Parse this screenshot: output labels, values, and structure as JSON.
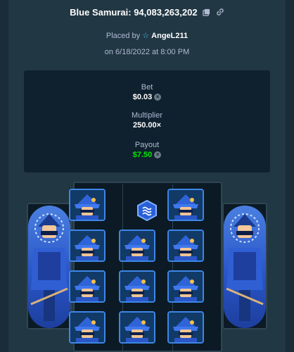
{
  "bet_title": "Blue Samurai: 94,083,263,202",
  "placed_prefix": "Placed by",
  "username": "AngeL211",
  "date_line": "on 6/18/2022 at 8:00 PM",
  "stats": {
    "bet_label": "Bet",
    "bet_value": "$0.03",
    "multiplier_label": "Multiplier",
    "multiplier_value": "250.00×",
    "payout_label": "Payout",
    "payout_value": "$7.50"
  },
  "colors": {
    "payout_green": "#00e701",
    "user_star": "#46c9e8",
    "tile_border": "#3d86e8"
  },
  "icons": {
    "copy": "copy-icon",
    "link": "link-icon",
    "star": "star-icon",
    "coin": "currency-icon",
    "scatter": "scatter-symbol-icon",
    "samurai": "samurai-symbol-icon"
  }
}
